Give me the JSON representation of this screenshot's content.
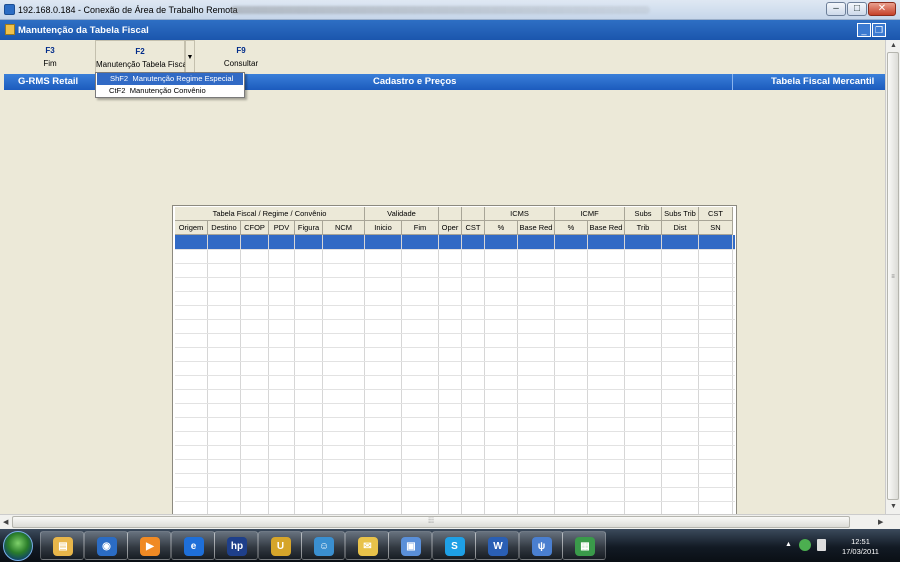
{
  "rdp": {
    "title": "192.168.0.184 - Conexão de Área de Trabalho Remota"
  },
  "app": {
    "title": "Manutenção da Tabela Fiscal"
  },
  "fkeys": [
    {
      "key": "F3",
      "label": "Fim"
    },
    {
      "key": "F2",
      "label": "Manutenção Tabela Fiscal"
    },
    {
      "key": "F9",
      "label": "Consultar"
    }
  ],
  "dropdown": {
    "items": [
      {
        "shortcut": "ShF2",
        "label": "Manutenção Regime Especial",
        "selected": true
      },
      {
        "shortcut": "CtF2",
        "label": "Manutenção Convênio",
        "selected": false
      }
    ]
  },
  "bluebar": {
    "left": "G-RMS Retail",
    "center": "Cadastro e Preços",
    "right": "Tabela Fiscal Mercantil"
  },
  "grid": {
    "groups": [
      "Tabela Fiscal / Regime / Convênio",
      "Validade",
      "",
      "",
      "ICMS",
      "ICMF",
      "Subs",
      "Subs Trib",
      "CST"
    ],
    "columns": [
      "Origem",
      "Destino",
      "CFOP",
      "PDV",
      "Figura",
      "NCM",
      "Inicio",
      "Fim",
      "Oper",
      "CST",
      "%",
      "Base Red",
      "%",
      "Base Red",
      "Trib",
      "Dist",
      "SN"
    ],
    "rows": []
  },
  "tray": {
    "time": "12:51",
    "date": "17/03/2011"
  },
  "taskbar": [
    "explorer",
    "media-player",
    "media-center",
    "internet-explorer",
    "hp",
    "util",
    "people",
    "mail",
    "remote-desktop",
    "skype",
    "word",
    "tool",
    "app"
  ],
  "colors": {
    "accent": "#316ac5",
    "panel": "#ece9d8",
    "title": "#1b56ad"
  }
}
